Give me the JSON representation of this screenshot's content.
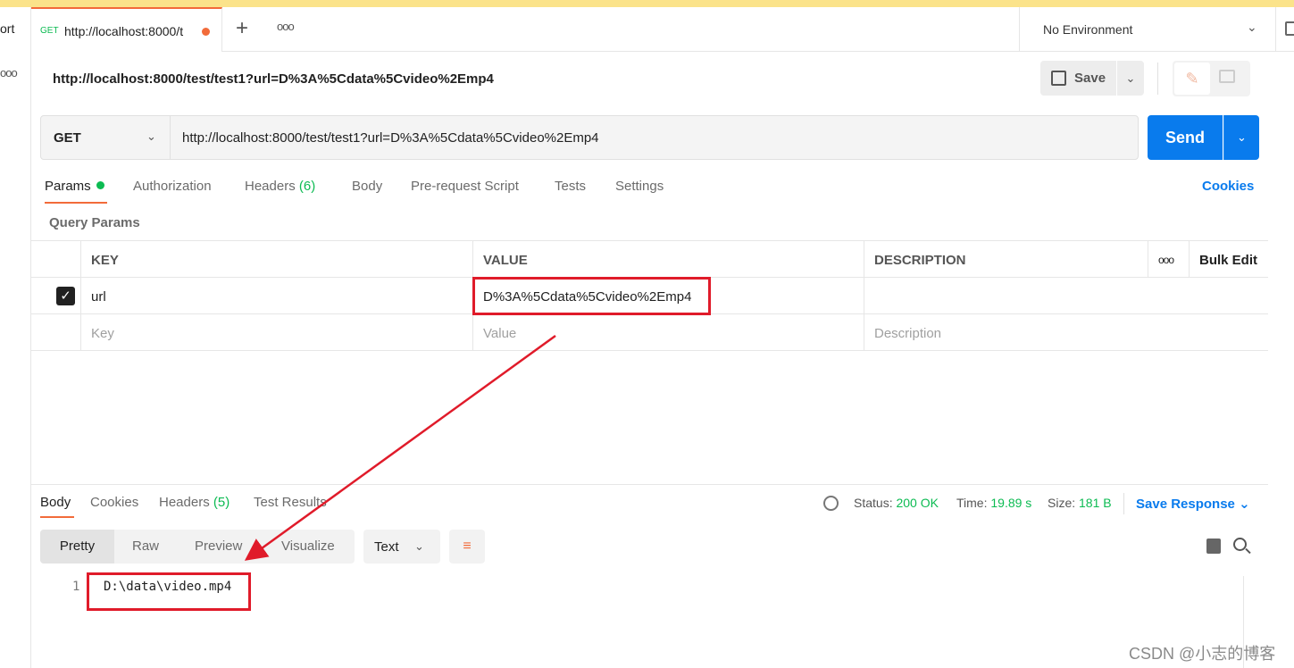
{
  "colors": {
    "accent_orange": "#f26b3a",
    "primary_blue": "#097bed",
    "success_green": "#0cbb52",
    "annotation_red": "#e01b2a"
  },
  "sidebar": {
    "partial_label": "ort",
    "more_icon": "more-icon"
  },
  "tabbar": {
    "tab": {
      "method": "GET",
      "title": "http://localhost:8000/t"
    },
    "new_tab": "+",
    "environment": "No Environment"
  },
  "request": {
    "title": "http://localhost:8000/test/test1?url=D%3A%5Cdata%5Cvideo%2Emp4",
    "save_label": "Save",
    "method": "GET",
    "url": "http://localhost:8000/test/test1?url=D%3A%5Cdata%5Cvideo%2Emp4",
    "send_label": "Send",
    "tabs": [
      {
        "label": "Params"
      },
      {
        "label": "Authorization"
      },
      {
        "label": "Headers",
        "count": "(6)"
      },
      {
        "label": "Body"
      },
      {
        "label": "Pre-request Script"
      },
      {
        "label": "Tests"
      },
      {
        "label": "Settings"
      }
    ],
    "cookies_label": "Cookies",
    "query_params_label": "Query Params",
    "table": {
      "headers": {
        "key": "KEY",
        "value": "VALUE",
        "description": "DESCRIPTION",
        "bulk_edit": "Bulk Edit"
      },
      "rows": [
        {
          "key": "url",
          "value": "D%3A%5Cdata%5Cvideo%2Emp4",
          "description": ""
        }
      ],
      "placeholders": {
        "key": "Key",
        "value": "Value",
        "description": "Description"
      }
    }
  },
  "response": {
    "tabs": [
      {
        "label": "Body"
      },
      {
        "label": "Cookies"
      },
      {
        "label": "Headers",
        "count": "(5)"
      },
      {
        "label": "Test Results"
      }
    ],
    "status_label": "Status:",
    "status_value": "200 OK",
    "time_label": "Time:",
    "time_value": "19.89 s",
    "size_label": "Size:",
    "size_value": "181 B",
    "save_response_label": "Save Response",
    "views": [
      "Pretty",
      "Raw",
      "Preview",
      "Visualize"
    ],
    "format": "Text",
    "line_number": "1",
    "body": "D:\\data\\video.mp4"
  },
  "watermark": "CSDN @小志的博客"
}
